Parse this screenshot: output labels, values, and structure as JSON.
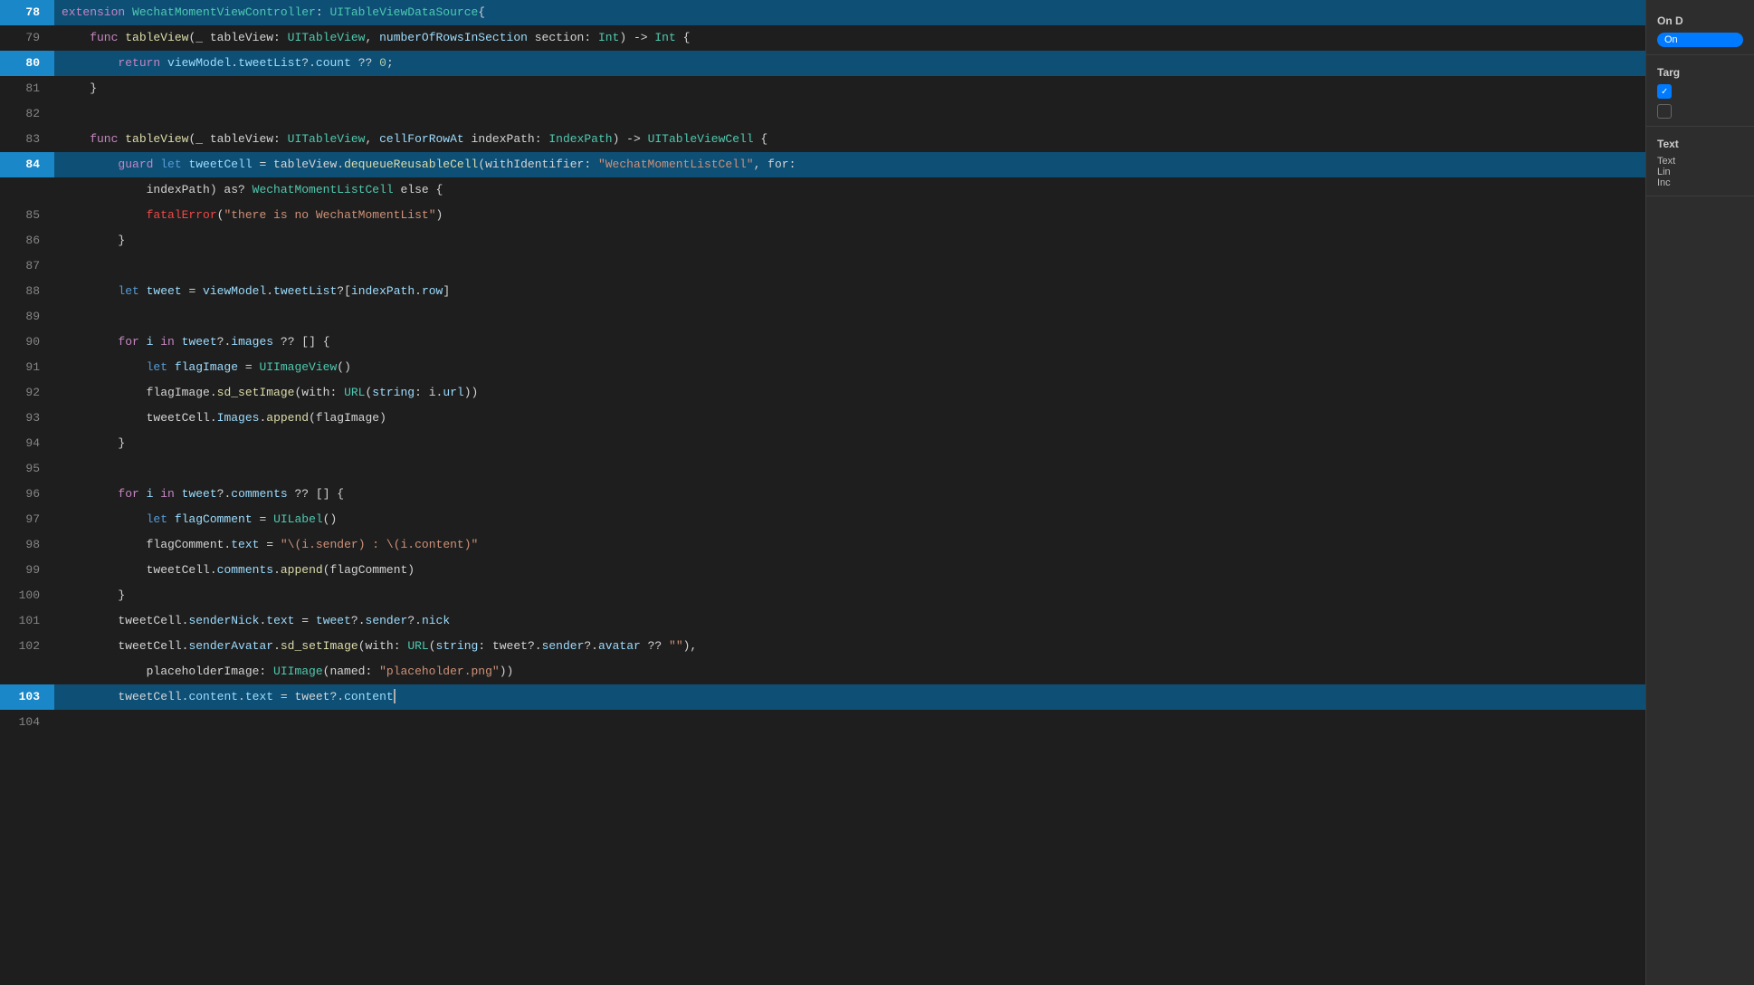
{
  "editor": {
    "lines": [
      {
        "number": "78",
        "highlight": true,
        "active": false,
        "tokens": [
          {
            "text": "extension ",
            "class": "kw"
          },
          {
            "text": "WechatMomentViewController",
            "class": "type"
          },
          {
            "text": ": ",
            "class": "plain"
          },
          {
            "text": "UITableViewDataSource",
            "class": "type"
          },
          {
            "text": "{",
            "class": "plain"
          }
        ]
      },
      {
        "number": "79",
        "highlight": false,
        "active": false,
        "tokens": [
          {
            "text": "    func ",
            "class": "kw"
          },
          {
            "text": "tableView",
            "class": "fn"
          },
          {
            "text": "(_ tableView: ",
            "class": "plain"
          },
          {
            "text": "UITableView",
            "class": "type"
          },
          {
            "text": ", ",
            "class": "plain"
          },
          {
            "text": "numberOfRowsInSection",
            "class": "param"
          },
          {
            "text": " section: ",
            "class": "plain"
          },
          {
            "text": "Int",
            "class": "type"
          },
          {
            "text": ") -> ",
            "class": "plain"
          },
          {
            "text": "Int",
            "class": "type"
          },
          {
            "text": " {",
            "class": "plain"
          }
        ]
      },
      {
        "number": "80",
        "highlight": true,
        "active": false,
        "tokens": [
          {
            "text": "        return ",
            "class": "kw"
          },
          {
            "text": "viewModel",
            "class": "var"
          },
          {
            "text": ".",
            "class": "plain"
          },
          {
            "text": "tweetList",
            "class": "prop"
          },
          {
            "text": "?.",
            "class": "plain"
          },
          {
            "text": "count",
            "class": "prop"
          },
          {
            "text": " ?? ",
            "class": "plain"
          },
          {
            "text": "0",
            "class": "num"
          },
          {
            "text": ";",
            "class": "plain"
          }
        ]
      },
      {
        "number": "81",
        "highlight": false,
        "active": false,
        "tokens": [
          {
            "text": "    }",
            "class": "plain"
          }
        ]
      },
      {
        "number": "82",
        "highlight": false,
        "active": false,
        "tokens": []
      },
      {
        "number": "83",
        "highlight": false,
        "active": false,
        "tokens": [
          {
            "text": "    func ",
            "class": "kw"
          },
          {
            "text": "tableView",
            "class": "fn"
          },
          {
            "text": "(_ tableView: ",
            "class": "plain"
          },
          {
            "text": "UITableView",
            "class": "type"
          },
          {
            "text": ", ",
            "class": "plain"
          },
          {
            "text": "cellForRowAt",
            "class": "param"
          },
          {
            "text": " indexPath: ",
            "class": "plain"
          },
          {
            "text": "IndexPath",
            "class": "type"
          },
          {
            "text": ") -> ",
            "class": "plain"
          },
          {
            "text": "UITableViewCell",
            "class": "type"
          },
          {
            "text": " {",
            "class": "plain"
          }
        ]
      },
      {
        "number": "84",
        "highlight": true,
        "active": false,
        "tokens": [
          {
            "text": "        guard ",
            "class": "kw"
          },
          {
            "text": "let ",
            "class": "kw-blue"
          },
          {
            "text": "tweetCell",
            "class": "var"
          },
          {
            "text": " = tableView.",
            "class": "plain"
          },
          {
            "text": "dequeueReusableCell",
            "class": "method"
          },
          {
            "text": "(withIdentifier: ",
            "class": "plain"
          },
          {
            "text": "\"WechatMomentListCell\"",
            "class": "str"
          },
          {
            "text": ", for:",
            "class": "plain"
          }
        ]
      },
      {
        "number": "",
        "highlight": false,
        "active": false,
        "indent": true,
        "tokens": [
          {
            "text": "            indexPath) as? ",
            "class": "plain"
          },
          {
            "text": "WechatMomentListCell",
            "class": "type"
          },
          {
            "text": " else {",
            "class": "plain"
          }
        ]
      },
      {
        "number": "85",
        "highlight": false,
        "active": false,
        "tokens": [
          {
            "text": "            ",
            "class": "plain"
          },
          {
            "text": "fatalError",
            "class": "comment-red"
          },
          {
            "text": "(",
            "class": "plain"
          },
          {
            "text": "\"there is no WechatMomentList\"",
            "class": "str"
          },
          {
            "text": ")",
            "class": "plain"
          }
        ]
      },
      {
        "number": "86",
        "highlight": false,
        "active": false,
        "tokens": [
          {
            "text": "        }",
            "class": "plain"
          }
        ]
      },
      {
        "number": "87",
        "highlight": false,
        "active": false,
        "tokens": []
      },
      {
        "number": "88",
        "highlight": false,
        "active": false,
        "tokens": [
          {
            "text": "        let ",
            "class": "kw-blue"
          },
          {
            "text": "tweet",
            "class": "var"
          },
          {
            "text": " = ",
            "class": "plain"
          },
          {
            "text": "viewModel",
            "class": "var"
          },
          {
            "text": ".",
            "class": "plain"
          },
          {
            "text": "tweetList",
            "class": "prop"
          },
          {
            "text": "?[",
            "class": "plain"
          },
          {
            "text": "indexPath",
            "class": "var"
          },
          {
            "text": ".",
            "class": "plain"
          },
          {
            "text": "row",
            "class": "prop"
          },
          {
            "text": "]",
            "class": "plain"
          }
        ]
      },
      {
        "number": "89",
        "highlight": false,
        "active": false,
        "tokens": []
      },
      {
        "number": "90",
        "highlight": false,
        "active": false,
        "tokens": [
          {
            "text": "        for ",
            "class": "kw"
          },
          {
            "text": "i",
            "class": "var"
          },
          {
            "text": " in ",
            "class": "kw"
          },
          {
            "text": "tweet",
            "class": "var"
          },
          {
            "text": "?.",
            "class": "plain"
          },
          {
            "text": "images",
            "class": "prop"
          },
          {
            "text": " ?? [] {",
            "class": "plain"
          }
        ]
      },
      {
        "number": "91",
        "highlight": false,
        "active": false,
        "tokens": [
          {
            "text": "            let ",
            "class": "kw-blue"
          },
          {
            "text": "flagImage",
            "class": "var"
          },
          {
            "text": " = ",
            "class": "plain"
          },
          {
            "text": "UIImageView",
            "class": "type"
          },
          {
            "text": "()",
            "class": "plain"
          }
        ]
      },
      {
        "number": "92",
        "highlight": false,
        "active": false,
        "tokens": [
          {
            "text": "            flagImage.",
            "class": "plain"
          },
          {
            "text": "sd_setImage",
            "class": "method"
          },
          {
            "text": "(with: ",
            "class": "plain"
          },
          {
            "text": "URL",
            "class": "type"
          },
          {
            "text": "(",
            "class": "plain"
          },
          {
            "text": "string",
            "class": "param"
          },
          {
            "text": ": i.",
            "class": "plain"
          },
          {
            "text": "url",
            "class": "prop"
          },
          {
            "text": "))",
            "class": "plain"
          }
        ]
      },
      {
        "number": "93",
        "highlight": false,
        "active": false,
        "tokens": [
          {
            "text": "            tweetCell.",
            "class": "plain"
          },
          {
            "text": "Images",
            "class": "prop"
          },
          {
            "text": ".",
            "class": "plain"
          },
          {
            "text": "append",
            "class": "method"
          },
          {
            "text": "(flagImage)",
            "class": "plain"
          }
        ]
      },
      {
        "number": "94",
        "highlight": false,
        "active": false,
        "tokens": [
          {
            "text": "        }",
            "class": "plain"
          }
        ]
      },
      {
        "number": "95",
        "highlight": false,
        "active": false,
        "tokens": []
      },
      {
        "number": "96",
        "highlight": false,
        "active": false,
        "tokens": [
          {
            "text": "        for ",
            "class": "kw"
          },
          {
            "text": "i",
            "class": "var"
          },
          {
            "text": " in ",
            "class": "kw"
          },
          {
            "text": "tweet",
            "class": "var"
          },
          {
            "text": "?.",
            "class": "plain"
          },
          {
            "text": "comments",
            "class": "prop"
          },
          {
            "text": " ?? [] {",
            "class": "plain"
          }
        ]
      },
      {
        "number": "97",
        "highlight": false,
        "active": false,
        "tokens": [
          {
            "text": "            let ",
            "class": "kw-blue"
          },
          {
            "text": "flagComment",
            "class": "var"
          },
          {
            "text": " = ",
            "class": "plain"
          },
          {
            "text": "UILabel",
            "class": "type"
          },
          {
            "text": "()",
            "class": "plain"
          }
        ]
      },
      {
        "number": "98",
        "highlight": false,
        "active": false,
        "tokens": [
          {
            "text": "            flagComment.",
            "class": "plain"
          },
          {
            "text": "text",
            "class": "prop"
          },
          {
            "text": " = ",
            "class": "plain"
          },
          {
            "text": "\"\\(i.",
            "class": "str"
          },
          {
            "text": "sender",
            "class": "str"
          },
          {
            "text": ") : \\(i.",
            "class": "str"
          },
          {
            "text": "content",
            "class": "str"
          },
          {
            "text": ")\"",
            "class": "str"
          }
        ]
      },
      {
        "number": "99",
        "highlight": false,
        "active": false,
        "tokens": [
          {
            "text": "            tweetCell.",
            "class": "plain"
          },
          {
            "text": "comments",
            "class": "prop"
          },
          {
            "text": ".",
            "class": "plain"
          },
          {
            "text": "append",
            "class": "method"
          },
          {
            "text": "(flagComment)",
            "class": "plain"
          }
        ]
      },
      {
        "number": "100",
        "highlight": false,
        "active": false,
        "tokens": [
          {
            "text": "        }",
            "class": "plain"
          }
        ]
      },
      {
        "number": "101",
        "highlight": false,
        "active": false,
        "tokens": [
          {
            "text": "        tweetCell.",
            "class": "plain"
          },
          {
            "text": "senderNick",
            "class": "prop"
          },
          {
            "text": ".",
            "class": "plain"
          },
          {
            "text": "text",
            "class": "prop"
          },
          {
            "text": " = ",
            "class": "plain"
          },
          {
            "text": "tweet",
            "class": "var"
          },
          {
            "text": "?.",
            "class": "plain"
          },
          {
            "text": "sender",
            "class": "prop"
          },
          {
            "text": "?.",
            "class": "plain"
          },
          {
            "text": "nick",
            "class": "prop"
          }
        ]
      },
      {
        "number": "102",
        "highlight": false,
        "active": false,
        "tokens": [
          {
            "text": "        tweetCell.",
            "class": "plain"
          },
          {
            "text": "senderAvatar",
            "class": "prop"
          },
          {
            "text": ".",
            "class": "plain"
          },
          {
            "text": "sd_setImage",
            "class": "method"
          },
          {
            "text": "(with: ",
            "class": "plain"
          },
          {
            "text": "URL",
            "class": "type"
          },
          {
            "text": "(",
            "class": "plain"
          },
          {
            "text": "string",
            "class": "param"
          },
          {
            "text": ": tweet?.",
            "class": "plain"
          },
          {
            "text": "sender",
            "class": "prop"
          },
          {
            "text": "?.",
            "class": "plain"
          },
          {
            "text": "avatar",
            "class": "prop"
          },
          {
            "text": " ?? ",
            "class": "plain"
          },
          {
            "text": "\"\"",
            "class": "str"
          },
          {
            "text": "),",
            "class": "plain"
          }
        ]
      },
      {
        "number": "",
        "highlight": false,
        "active": false,
        "indent": true,
        "tokens": [
          {
            "text": "            placeholderImage: ",
            "class": "plain"
          },
          {
            "text": "UIImage",
            "class": "type"
          },
          {
            "text": "(named: ",
            "class": "plain"
          },
          {
            "text": "\"placeholder.png\"",
            "class": "str"
          },
          {
            "text": "))",
            "class": "plain"
          }
        ]
      },
      {
        "number": "103",
        "highlight": true,
        "active": true,
        "tokens": [
          {
            "text": "        tweetCell.",
            "class": "plain"
          },
          {
            "text": "content",
            "class": "prop"
          },
          {
            "text": ".",
            "class": "plain"
          },
          {
            "text": "text",
            "class": "prop"
          },
          {
            "text": " = tweet?.",
            "class": "plain"
          },
          {
            "text": "content",
            "class": "prop"
          },
          {
            "text": "|cursor|",
            "class": "cursor-marker"
          }
        ]
      },
      {
        "number": "104",
        "highlight": false,
        "active": false,
        "tokens": []
      }
    ]
  },
  "right_panel": {
    "on_section": {
      "label": "On D",
      "toggle_text": "On"
    },
    "target_section": {
      "label": "Targ",
      "checkbox1_checked": true,
      "checkbox2_checked": false
    },
    "text_section": {
      "label": "Text",
      "line1": "Text",
      "line2": "Lin",
      "line3": "Inc"
    }
  }
}
